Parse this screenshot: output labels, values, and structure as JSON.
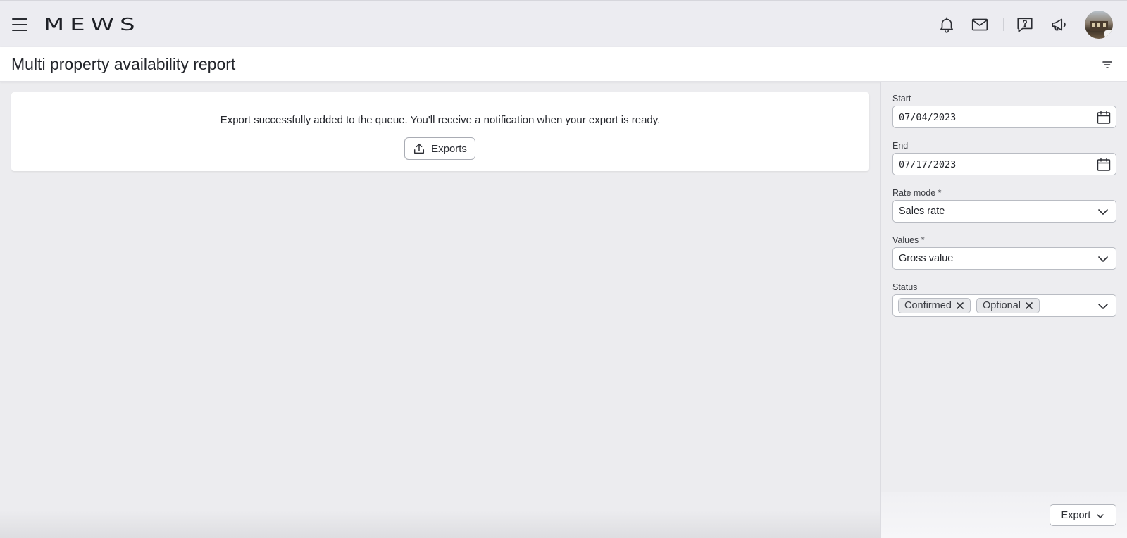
{
  "app": {
    "logo_text": "MEWS"
  },
  "topbar": {
    "icons": [
      "menu-icon",
      "bell-icon",
      "mail-icon",
      "help-icon",
      "megaphone-icon",
      "avatar"
    ]
  },
  "page": {
    "title": "Multi property availability report"
  },
  "notice": {
    "message": "Export successfully added to the queue. You'll receive a notification when your export is ready.",
    "exports_button_label": "Exports"
  },
  "filters": {
    "start": {
      "label": "Start",
      "value": "07/04/2023"
    },
    "end": {
      "label": "End",
      "value": "07/17/2023"
    },
    "rate_mode": {
      "label": "Rate mode *",
      "value": "Sales rate"
    },
    "values": {
      "label": "Values *",
      "value": "Gross value"
    },
    "status": {
      "label": "Status",
      "chips": [
        "Confirmed",
        "Optional"
      ]
    }
  },
  "footer": {
    "export_button_label": "Export"
  },
  "colors": {
    "background": "#ececef",
    "surface": "#ffffff",
    "text": "#24262b",
    "border": "#b9bcc3"
  }
}
